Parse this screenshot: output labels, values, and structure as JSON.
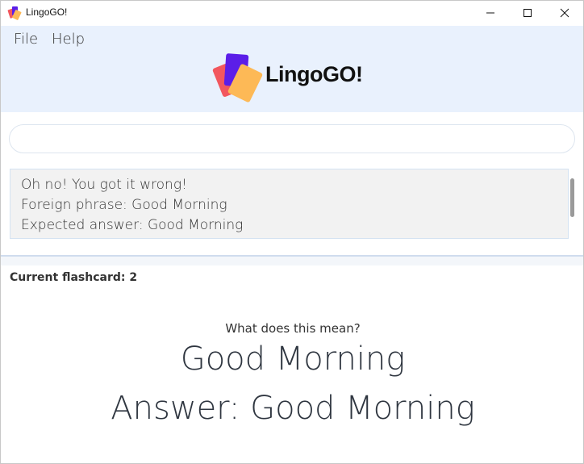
{
  "window": {
    "title": "LingoGO!"
  },
  "menu": {
    "items": [
      "File",
      "Help"
    ]
  },
  "logo": {
    "text": "LingoGO!"
  },
  "command": {
    "value": ""
  },
  "result": {
    "lines": [
      "Oh no! You got it wrong!",
      "Foreign phrase: Good Morning",
      "Expected answer: Good Morning"
    ]
  },
  "flashcard": {
    "current_label": "Current flashcard: 2",
    "prompt": "What does this mean?",
    "phrase": "Good Morning",
    "answer": "Answer: Good Morning"
  },
  "colors": {
    "header_bg": "#e9f1fd",
    "logo_purple": "#5b1ee8",
    "logo_red": "#f2575e",
    "logo_orange": "#fdb956"
  }
}
